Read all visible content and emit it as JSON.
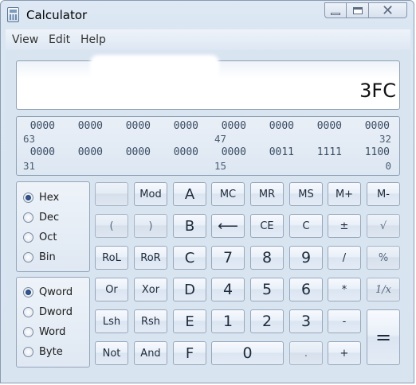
{
  "window": {
    "title": "Calculator"
  },
  "menu": {
    "items": [
      "View",
      "Edit",
      "Help"
    ]
  },
  "display": {
    "value": "3FC"
  },
  "bits": {
    "row1": [
      "0000",
      "0000",
      "0000",
      "0000",
      "0000",
      "0000",
      "0000",
      "0000"
    ],
    "row1_idx": [
      "63",
      "47",
      "32"
    ],
    "row2": [
      "0000",
      "0000",
      "0000",
      "0000",
      "0000",
      "0011",
      "1111",
      "1100"
    ],
    "row2_idx": [
      "31",
      "15",
      "0"
    ]
  },
  "base": {
    "options": [
      "Hex",
      "Dec",
      "Oct",
      "Bin"
    ],
    "selected": "Hex"
  },
  "word": {
    "options": [
      "Qword",
      "Dword",
      "Word",
      "Byte"
    ],
    "selected": "Qword"
  },
  "keys": {
    "blank": "",
    "mod": "Mod",
    "a": "A",
    "mc": "MC",
    "mr": "MR",
    "ms": "MS",
    "mplus": "M+",
    "mminus": "M-",
    "lparen": "(",
    "rparen": ")",
    "b": "B",
    "back": "⟵",
    "ce": "CE",
    "c": "C",
    "plusminus": "±",
    "sqrt": "√",
    "rol": "RoL",
    "ror": "RoR",
    "c_hex": "C",
    "k7": "7",
    "k8": "8",
    "k9": "9",
    "div": "/",
    "pct": "%",
    "or": "Or",
    "xor": "Xor",
    "d": "D",
    "k4": "4",
    "k5": "5",
    "k6": "6",
    "mul": "*",
    "recip": "1/x",
    "lsh": "Lsh",
    "rsh": "Rsh",
    "e": "E",
    "k1": "1",
    "k2": "2",
    "k3": "3",
    "sub": "-",
    "eq": "=",
    "not": "Not",
    "and": "And",
    "f": "F",
    "k0": "0",
    "dot": ".",
    "add": "+"
  }
}
